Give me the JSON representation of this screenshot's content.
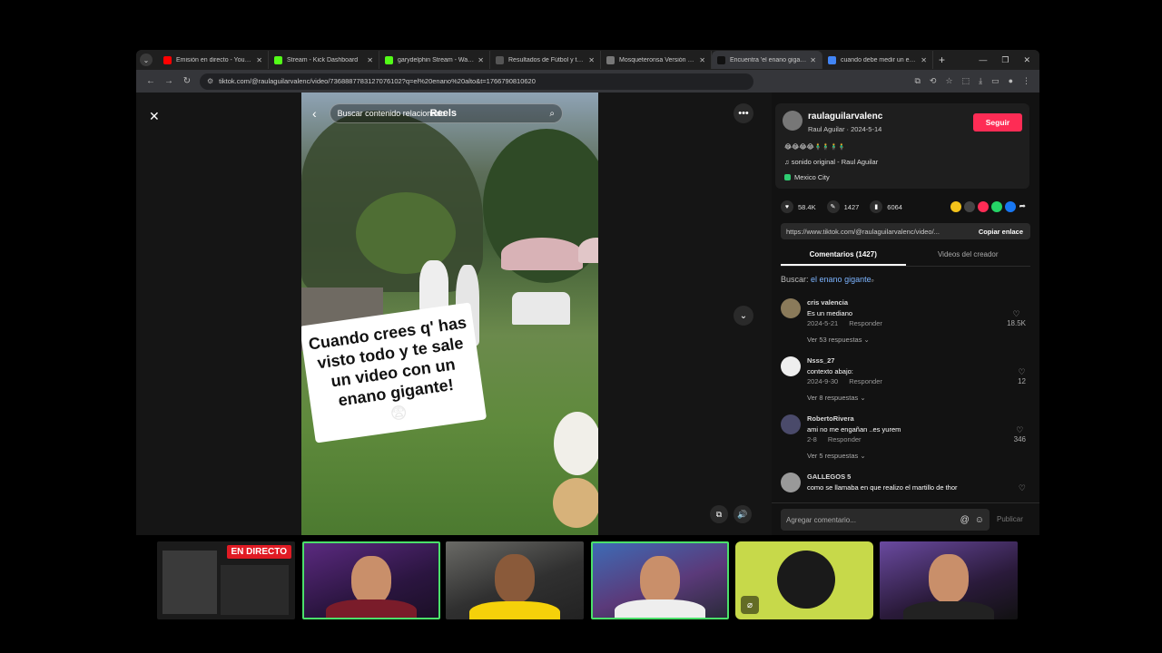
{
  "tabs": [
    {
      "title": "Emisión en directo - YouTube",
      "color": "#ff0000"
    },
    {
      "title": "Stream - Kick Dashboard",
      "color": "#53fc18"
    },
    {
      "title": "garydelphin Stream - Watch L",
      "color": "#53fc18"
    },
    {
      "title": "Resultados de Fútbol y tabla",
      "color": "#555555"
    },
    {
      "title": "Mosqueteronsa Versión Round",
      "color": "#777777"
    },
    {
      "title": "Encuentra 'el enano gigante'",
      "color": "#111111",
      "active": true
    },
    {
      "title": "cuando debe medir un enano",
      "color": "#4285f4"
    }
  ],
  "address": {
    "url": "tiktok.com/@raulaguilarvalenc/video/7368887783127076102?q=el%20enano%20alto&t=1766790810620"
  },
  "video": {
    "search_placeholder": "Buscar contenido relacionado",
    "reels_label": "Reels",
    "caption": "Cuando crees q' has visto todo y te sale un video con un enano gigante!",
    "caption_emoji": "😨"
  },
  "author": {
    "username": "raulaguilarvalenc",
    "subtitle": "Raul Aguilar · 2024-5-14",
    "follow_label": "Seguir",
    "emojis": "😂😂😂😂🧍‍♂️🧍‍♂️🧍‍♂️🧍‍♂️",
    "sound": "sonido original - Raul Aguilar",
    "location": "Mexico City"
  },
  "stats": {
    "likes": "58.4K",
    "comments": "1427",
    "saves": "6064"
  },
  "link": {
    "url": "https://www.tiktok.com/@raulaguilarvalenc/video/...",
    "copy_label": "Copiar enlace"
  },
  "panel_tabs": {
    "comments": "Comentarios (1427)",
    "creator": "Videos del creador"
  },
  "search": {
    "prefix": "Buscar:",
    "term": "el enano gigante"
  },
  "comments": [
    {
      "user": "cris valencia",
      "text": "Es un mediano",
      "date": "2024-5-21",
      "reply": "Responder",
      "more": "Ver 53 respuestas",
      "likes": "18.5K",
      "avatar_color": "#8a7a5a"
    },
    {
      "user": "Nsss_27",
      "text": "contexto abajo:",
      "date": "2024-9-30",
      "reply": "Responder",
      "more": "Ver 8 respuestas",
      "likes": "12",
      "avatar_color": "#eeeeee"
    },
    {
      "user": "RobertoRivera",
      "text": "ami no me engañan ..es yurem",
      "date": "2-8",
      "reply": "Responder",
      "more": "Ver 5 respuestas",
      "likes": "346",
      "avatar_color": "#4a4a6a"
    },
    {
      "user": "GALLEGOS 5",
      "text": "como se llamaba en que realizo el martillo de thor",
      "date": "",
      "reply": "",
      "more": "",
      "likes": "",
      "avatar_color": "#999999"
    }
  ],
  "comment_input": {
    "placeholder": "Agregar comentario...",
    "post_label": "Publicar"
  },
  "webcams": {
    "live_label": "EN DIRECTO"
  }
}
